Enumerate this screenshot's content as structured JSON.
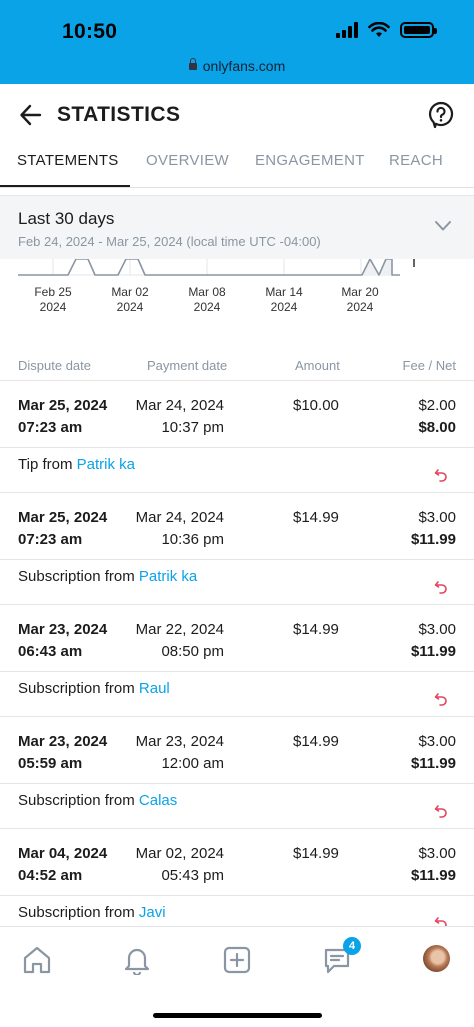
{
  "status_bar": {
    "time": "10:50",
    "url": "onlyfans.com"
  },
  "header": {
    "title": "STATISTICS"
  },
  "tabs": [
    {
      "label": "STATEMENTS",
      "active": true
    },
    {
      "label": "OVERVIEW",
      "active": false
    },
    {
      "label": "ENGAGEMENT",
      "active": false
    },
    {
      "label": "REACH",
      "active": false
    }
  ],
  "period": {
    "label": "Last 30 days",
    "range": "Feb 24, 2024 - Mar 25, 2024 (local time UTC -04:00)"
  },
  "chart": {
    "ticks": [
      {
        "date": "Feb 25",
        "year": "2024"
      },
      {
        "date": "Mar 02",
        "year": "2024"
      },
      {
        "date": "Mar 08",
        "year": "2024"
      },
      {
        "date": "Mar 14",
        "year": "2024"
      },
      {
        "date": "Mar 20",
        "year": "2024"
      }
    ]
  },
  "table": {
    "headers": {
      "dispute": "Dispute date",
      "payment": "Payment date",
      "amount": "Amount",
      "fee_net": "Fee / Net"
    },
    "rows": [
      {
        "dispute_date": "Mar 25, 2024",
        "dispute_time": "07:23 am",
        "payment_date": "Mar 24, 2024",
        "payment_time": "10:37 pm",
        "amount": "$10.00",
        "fee": "$2.00",
        "net": "$8.00",
        "type": "Tip from",
        "from": "Patrik ka"
      },
      {
        "dispute_date": "Mar 25, 2024",
        "dispute_time": "07:23 am",
        "payment_date": "Mar 24, 2024",
        "payment_time": "10:36 pm",
        "amount": "$14.99",
        "fee": "$3.00",
        "net": "$11.99",
        "type": "Subscription from",
        "from": "Patrik ka"
      },
      {
        "dispute_date": "Mar 23, 2024",
        "dispute_time": "06:43 am",
        "payment_date": "Mar 22, 2024",
        "payment_time": "08:50 pm",
        "amount": "$14.99",
        "fee": "$3.00",
        "net": "$11.99",
        "type": "Subscription from",
        "from": "Raul"
      },
      {
        "dispute_date": "Mar 23, 2024",
        "dispute_time": "05:59 am",
        "payment_date": "Mar 23, 2024",
        "payment_time": "12:00 am",
        "amount": "$14.99",
        "fee": "$3.00",
        "net": "$11.99",
        "type": "Subscription from",
        "from": "Calas"
      },
      {
        "dispute_date": "Mar 04, 2024",
        "dispute_time": "04:52 am",
        "payment_date": "Mar 02, 2024",
        "payment_time": "05:43 pm",
        "amount": "$14.99",
        "fee": "$3.00",
        "net": "$11.99",
        "type": "Subscription from",
        "from": "Javi"
      }
    ]
  },
  "bottom_nav": {
    "items": [
      "home-icon",
      "bell-icon",
      "plus-square-icon",
      "messages-icon",
      "avatar"
    ],
    "messages_badge": "4"
  },
  "colors": {
    "accent": "#0aa3e8",
    "refund": "#e0465e",
    "muted": "#8a96a3"
  }
}
